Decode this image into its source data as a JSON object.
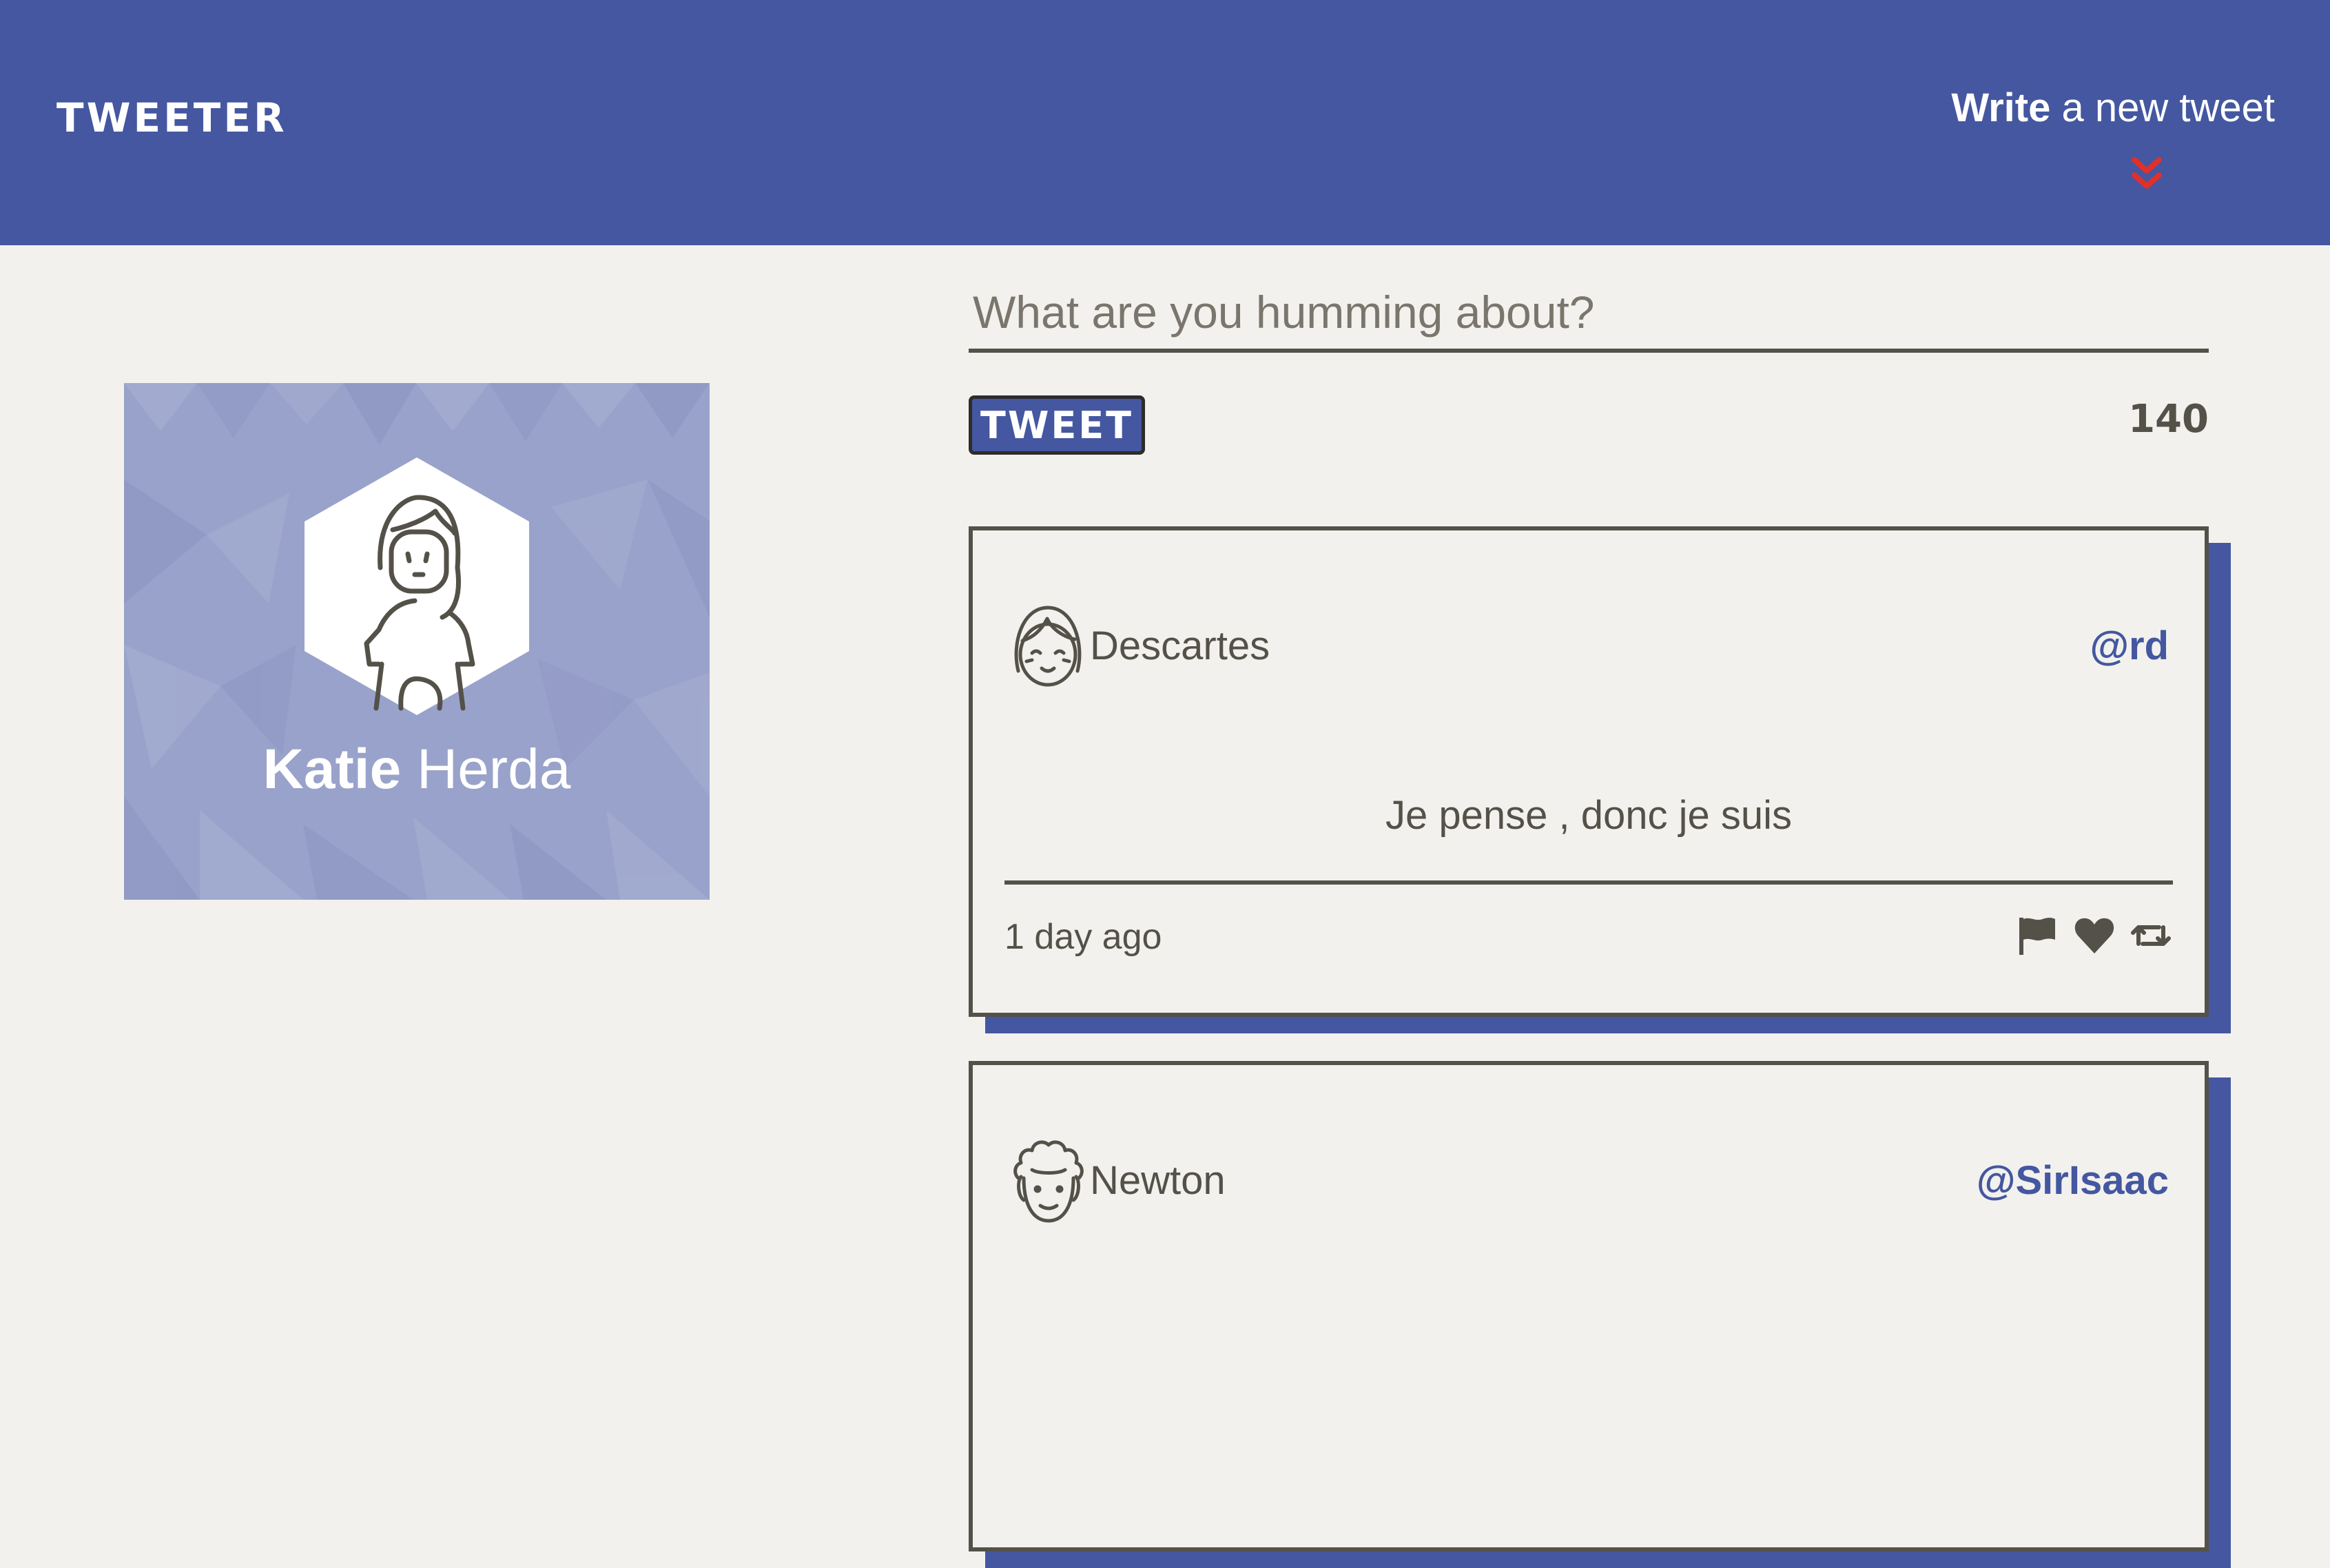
{
  "header": {
    "brand": "TWEETER",
    "compose_toggle_bold": "Write",
    "compose_toggle_rest": " a new tweet",
    "compose_toggle_icon": "chevron-double-down-icon",
    "colors": {
      "bar": "#4457a0",
      "arrow": "#e0302b",
      "text": "#ffffff"
    }
  },
  "profile": {
    "first_name": "Katie",
    "last_name": "Herda",
    "avatar_icon": "woman-avatar-icon",
    "colors": {
      "card": "#99a2ca",
      "hexagon": "#ffffff"
    }
  },
  "compose": {
    "placeholder": "What are you humming about?",
    "value": "",
    "tweet_button_label": "TWEET",
    "char_counter": "140"
  },
  "tweets": [
    {
      "author": "Descartes",
      "handle": "@rd",
      "avatar_icon": "girl-avatar-icon",
      "text": "Je pense , donc je suis",
      "time": "1 day ago",
      "actions": [
        "flag-icon",
        "heart-icon",
        "retweet-icon"
      ]
    },
    {
      "author": "Newton",
      "handle": "@SirIsaac",
      "avatar_icon": "curly-hair-avatar-icon"
    }
  ],
  "colors": {
    "background": "#f2f1ed",
    "accent": "#4457a0",
    "text": "#545149"
  }
}
